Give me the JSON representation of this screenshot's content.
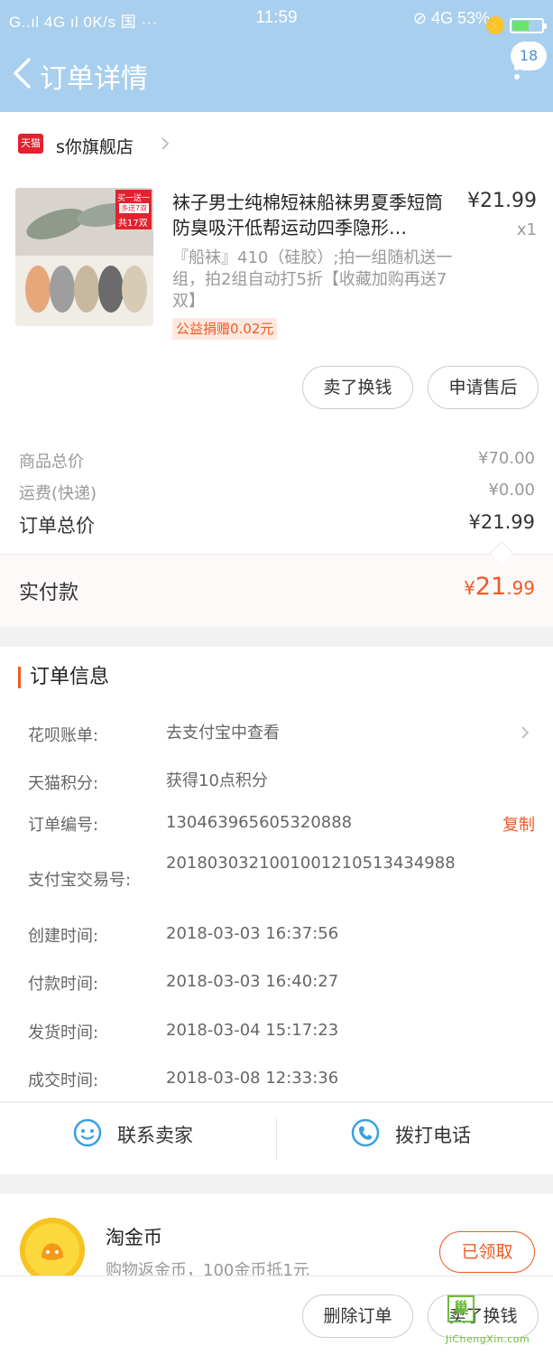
{
  "status_bar": {
    "left": "G..ıl 4G ıl 0K/s 国 ···",
    "time": "11:59",
    "right": "⊘ 4G 53%",
    "charge_icon": "⚡"
  },
  "header": {
    "title": "订单详情",
    "badge_count": "18",
    "back_icon": "chevron-left-icon",
    "more_icon": "more-vertical-icon"
  },
  "shop": {
    "logo_text": "天猫",
    "name": "s你旗舰店"
  },
  "product": {
    "title": "袜子男士纯棉短袜船袜男夏季短筒防臭吸汗低帮运动四季隐形…",
    "price": "¥21.99",
    "qty": "x1",
    "sku": "『船袜』410（硅胶）;拍一组随机送一组，拍2组自动打5折【收藏加购再送7双】",
    "charity": "公益捐赠0.02元",
    "image_badges": [
      "买一送一",
      "多送7双",
      "共17双"
    ]
  },
  "product_actions": {
    "sell": "卖了换钱",
    "after_sale": "申请售后"
  },
  "price_summary": {
    "goods_label": "商品总价",
    "goods_value": "¥70.00",
    "shipping_label": "运费(快递)",
    "shipping_value": "¥0.00",
    "total_label": "订单总价",
    "total_value": "¥21.99",
    "paid_label": "实付款",
    "paid_currency": "¥",
    "paid_int": "21",
    "paid_dec": ".99"
  },
  "order_info": {
    "title": "订单信息",
    "rows": [
      {
        "key": "花呗账单:",
        "value": "去支付宝中查看"
      },
      {
        "key": "天猫积分:",
        "value": "获得10点积分"
      },
      {
        "key": "订单编号:",
        "value": "130463965605320888",
        "action": "复制"
      },
      {
        "key": "支付宝交易号:",
        "value": "2018030321001001210513434988"
      },
      {
        "key": "创建时间:",
        "value": "2018-03-03 16:37:56"
      },
      {
        "key": "付款时间:",
        "value": "2018-03-03 16:40:27"
      },
      {
        "key": "发货时间:",
        "value": "2018-03-04 15:17:23"
      },
      {
        "key": "成交时间:",
        "value": "2018-03-08 12:33:36"
      }
    ]
  },
  "contact": {
    "seller": "联系卖家",
    "call": "拨打电话"
  },
  "coin": {
    "title": "淘金币",
    "subtitle": "购物返金币，100金币抵1元",
    "button": "已领取"
  },
  "bottom_bar": {
    "delete": "删除订单",
    "sell": "卖了换钱"
  },
  "watermark": {
    "mark": "巢",
    "text": "JiChengXin.com"
  },
  "colors": {
    "header_bg": "#a8cfee",
    "accent_orange": "#f05a24",
    "tmall_red": "#e3212f",
    "icon_blue": "#3aa0e6"
  }
}
